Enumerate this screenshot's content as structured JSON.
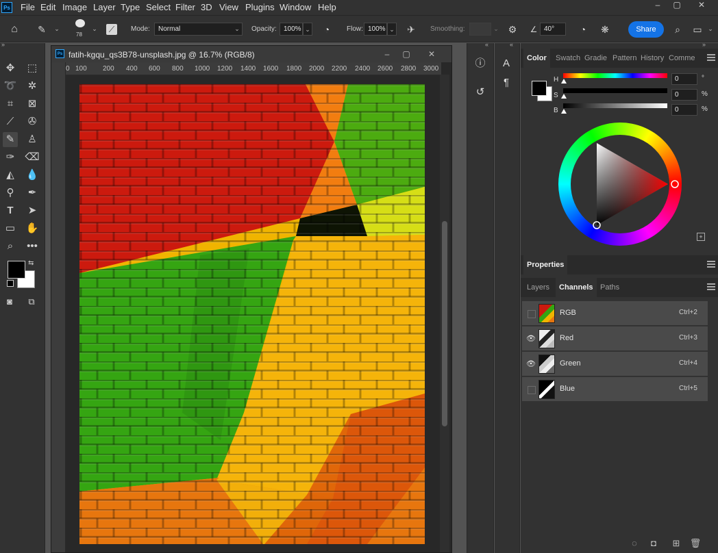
{
  "app": {
    "logo": "Ps"
  },
  "menu": [
    "File",
    "Edit",
    "Image",
    "Layer",
    "Type",
    "Select",
    "Filter",
    "3D",
    "View",
    "Plugins",
    "Window",
    "Help"
  ],
  "window_controls": [
    "–",
    "▢",
    "✕"
  ],
  "options_bar": {
    "brush_size": "78",
    "mode_label": "Mode:",
    "mode_value": "Normal",
    "opacity_label": "Opacity:",
    "opacity_value": "100%",
    "flow_label": "Flow:",
    "flow_value": "100%",
    "smoothing_label": "Smoothing:",
    "smoothing_value": "",
    "angle_value": "40°",
    "share_label": "Share"
  },
  "document": {
    "title": "fatih-kgqu_qs3B78-unsplash.jpg @ 16.7% (RGB/8)",
    "ruler_ticks": [
      "0",
      "100",
      "200",
      "400",
      "600",
      "800",
      "1000",
      "1200",
      "1400",
      "1600",
      "1800",
      "2000",
      "2200",
      "2400",
      "2600",
      "2800",
      "3000"
    ]
  },
  "color_panel": {
    "tabs": [
      "Color",
      "Swatch",
      "Gradie",
      "Pattern",
      "History",
      "Comme"
    ],
    "active_tab": "Color",
    "sliders": [
      {
        "label": "H",
        "value": "0",
        "unit": "°"
      },
      {
        "label": "S",
        "value": "0",
        "unit": "%"
      },
      {
        "label": "B",
        "value": "0",
        "unit": "%"
      }
    ],
    "colors": {
      "foreground": "#000000",
      "background": "#ffffff",
      "hue": "#ff0000"
    }
  },
  "properties_panel": {
    "title": "Properties"
  },
  "channels_panel": {
    "tabs": [
      "Layers",
      "Channels",
      "Paths"
    ],
    "active_tab": "Channels",
    "rows": [
      {
        "name": "RGB",
        "shortcut": "Ctrl+2",
        "visible": false
      },
      {
        "name": "Red",
        "shortcut": "Ctrl+3",
        "visible": true
      },
      {
        "name": "Green",
        "shortcut": "Ctrl+4",
        "visible": true
      },
      {
        "name": "Blue",
        "shortcut": "Ctrl+5",
        "visible": false
      }
    ]
  },
  "collapse_arrows": [
    "«",
    "»",
    "«",
    "»"
  ]
}
